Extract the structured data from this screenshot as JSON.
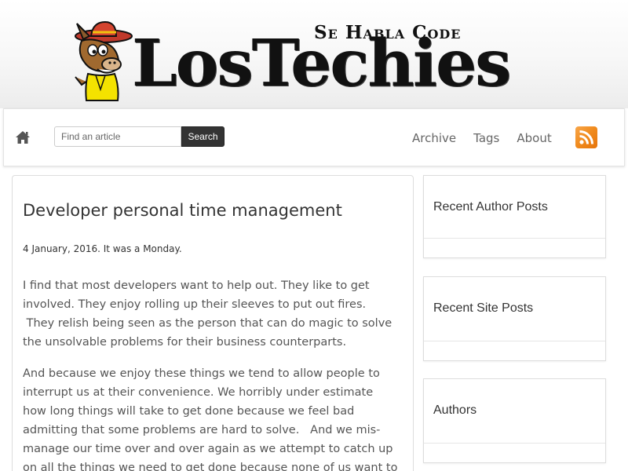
{
  "header": {
    "tagline": "Se Habla Code",
    "logotype": "LosTechies"
  },
  "navbar": {
    "search": {
      "placeholder": "Find an article",
      "button_label": "Search"
    },
    "links": [
      {
        "label": "Archive"
      },
      {
        "label": "Tags"
      },
      {
        "label": "About"
      }
    ],
    "icons": {
      "home": "home-icon",
      "rss": "rss-icon"
    },
    "colors": {
      "rss": "#f08a1c",
      "search_button": "#333333"
    }
  },
  "article": {
    "title": "Developer personal time management",
    "date": "4 January, 2016. It was a Monday.",
    "paragraphs": [
      [
        "I find that most developers want to help out.  They like to get",
        "involved.  They enjoy rolling up their sleeves to put out fires.",
        " They relish being seen as the person that can do magic to solve",
        "the unsolvable problems for their business counterparts."
      ],
      [
        "And because we enjoy these things we tend to allow people to",
        "interrupt us at their convenience.  We horribly under estimate",
        "how long things will take to get done because we feel bad",
        "admitting that some problems are hard to solve.   And we mis-",
        "manage our time over and over again as we attempt to catch up",
        "on all the things we need to get done because none of us want to"
      ]
    ]
  },
  "sidebar": {
    "widgets": [
      {
        "title": "Recent Author Posts"
      },
      {
        "title": "Recent Site Posts"
      },
      {
        "title": "Authors"
      }
    ]
  }
}
